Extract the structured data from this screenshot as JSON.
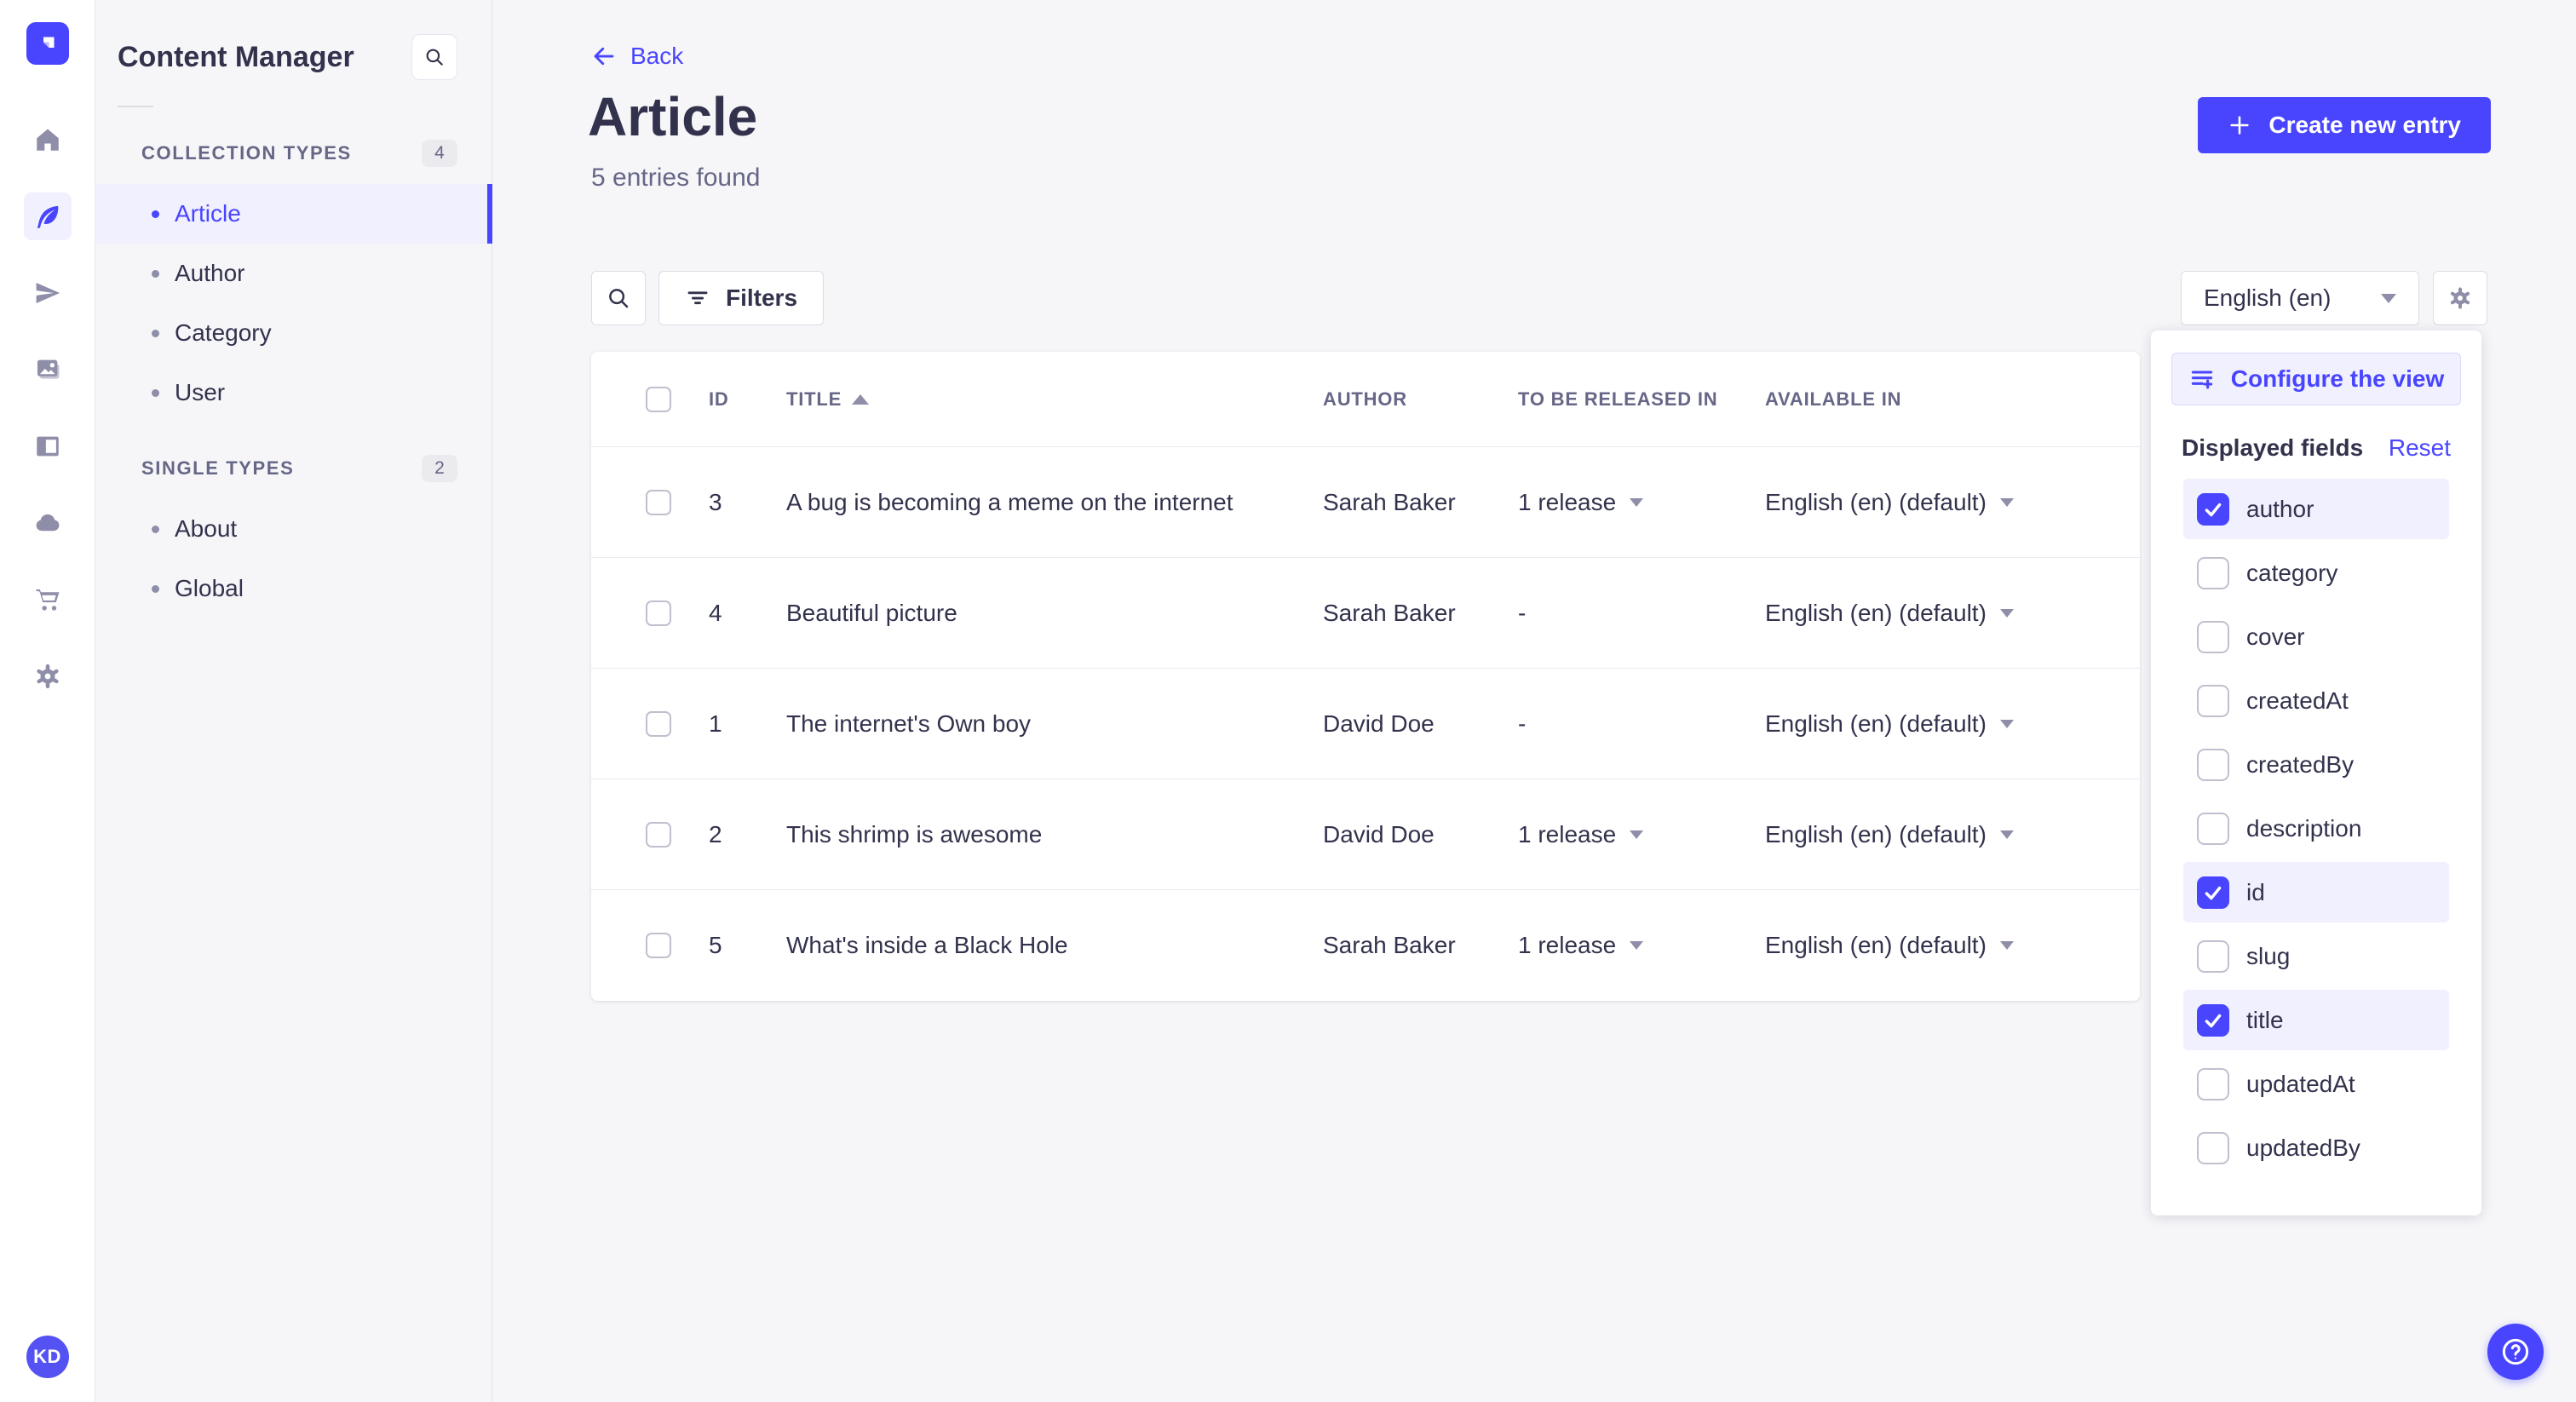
{
  "colors": {
    "accent": "#4945ff",
    "accent_light": "#f0f0ff",
    "accent_border": "#d9d8ff",
    "page_bg": "#f6f6f9",
    "text": "#32324d",
    "text_muted": "#666687",
    "icon_muted": "#8e8ea9"
  },
  "rail": {
    "avatar_initials": "KD"
  },
  "sidebar": {
    "title": "Content Manager",
    "sections": [
      {
        "label": "COLLECTION TYPES",
        "count": "4",
        "items": [
          {
            "label": "Article",
            "active": true
          },
          {
            "label": "Author",
            "active": false
          },
          {
            "label": "Category",
            "active": false
          },
          {
            "label": "User",
            "active": false
          }
        ]
      },
      {
        "label": "SINGLE TYPES",
        "count": "2",
        "items": [
          {
            "label": "About",
            "active": false
          },
          {
            "label": "Global",
            "active": false
          }
        ]
      }
    ]
  },
  "header": {
    "back_label": "Back",
    "title": "Article",
    "subtitle": "5 entries found",
    "create_button_label": "Create new entry"
  },
  "toolbar": {
    "filters_label": "Filters",
    "locale_value": "English (en)"
  },
  "table": {
    "columns": {
      "id": "ID",
      "title": "TITLE",
      "author": "AUTHOR",
      "release": "TO BE RELEASED IN",
      "available": "AVAILABLE IN"
    },
    "sorted_column": "TITLE",
    "sort_direction": "asc",
    "rows": [
      {
        "id": "3",
        "title": "A bug is becoming a meme on the internet",
        "author": "Sarah Baker",
        "release": "1 release",
        "has_release": true,
        "available": "English (en) (default)"
      },
      {
        "id": "4",
        "title": "Beautiful picture",
        "author": "Sarah Baker",
        "release": "-",
        "has_release": false,
        "available": "English (en) (default)"
      },
      {
        "id": "1",
        "title": "The internet's Own boy",
        "author": "David Doe",
        "release": "-",
        "has_release": false,
        "available": "English (en) (default)"
      },
      {
        "id": "2",
        "title": "This shrimp is awesome",
        "author": "David Doe",
        "release": "1 release",
        "has_release": true,
        "available": "English (en) (default)"
      },
      {
        "id": "5",
        "title": "What's inside a Black Hole",
        "author": "Sarah Baker",
        "release": "1 release",
        "has_release": true,
        "available": "English (en) (default)"
      }
    ]
  },
  "popover": {
    "configure_label": "Configure the view",
    "fields_title": "Displayed fields",
    "reset_label": "Reset",
    "fields": [
      {
        "label": "author",
        "checked": true
      },
      {
        "label": "category",
        "checked": false
      },
      {
        "label": "cover",
        "checked": false
      },
      {
        "label": "createdAt",
        "checked": false
      },
      {
        "label": "createdBy",
        "checked": false
      },
      {
        "label": "description",
        "checked": false
      },
      {
        "label": "id",
        "checked": true
      },
      {
        "label": "slug",
        "checked": false
      },
      {
        "label": "title",
        "checked": true
      },
      {
        "label": "updatedAt",
        "checked": false
      },
      {
        "label": "updatedBy",
        "checked": false
      }
    ]
  }
}
